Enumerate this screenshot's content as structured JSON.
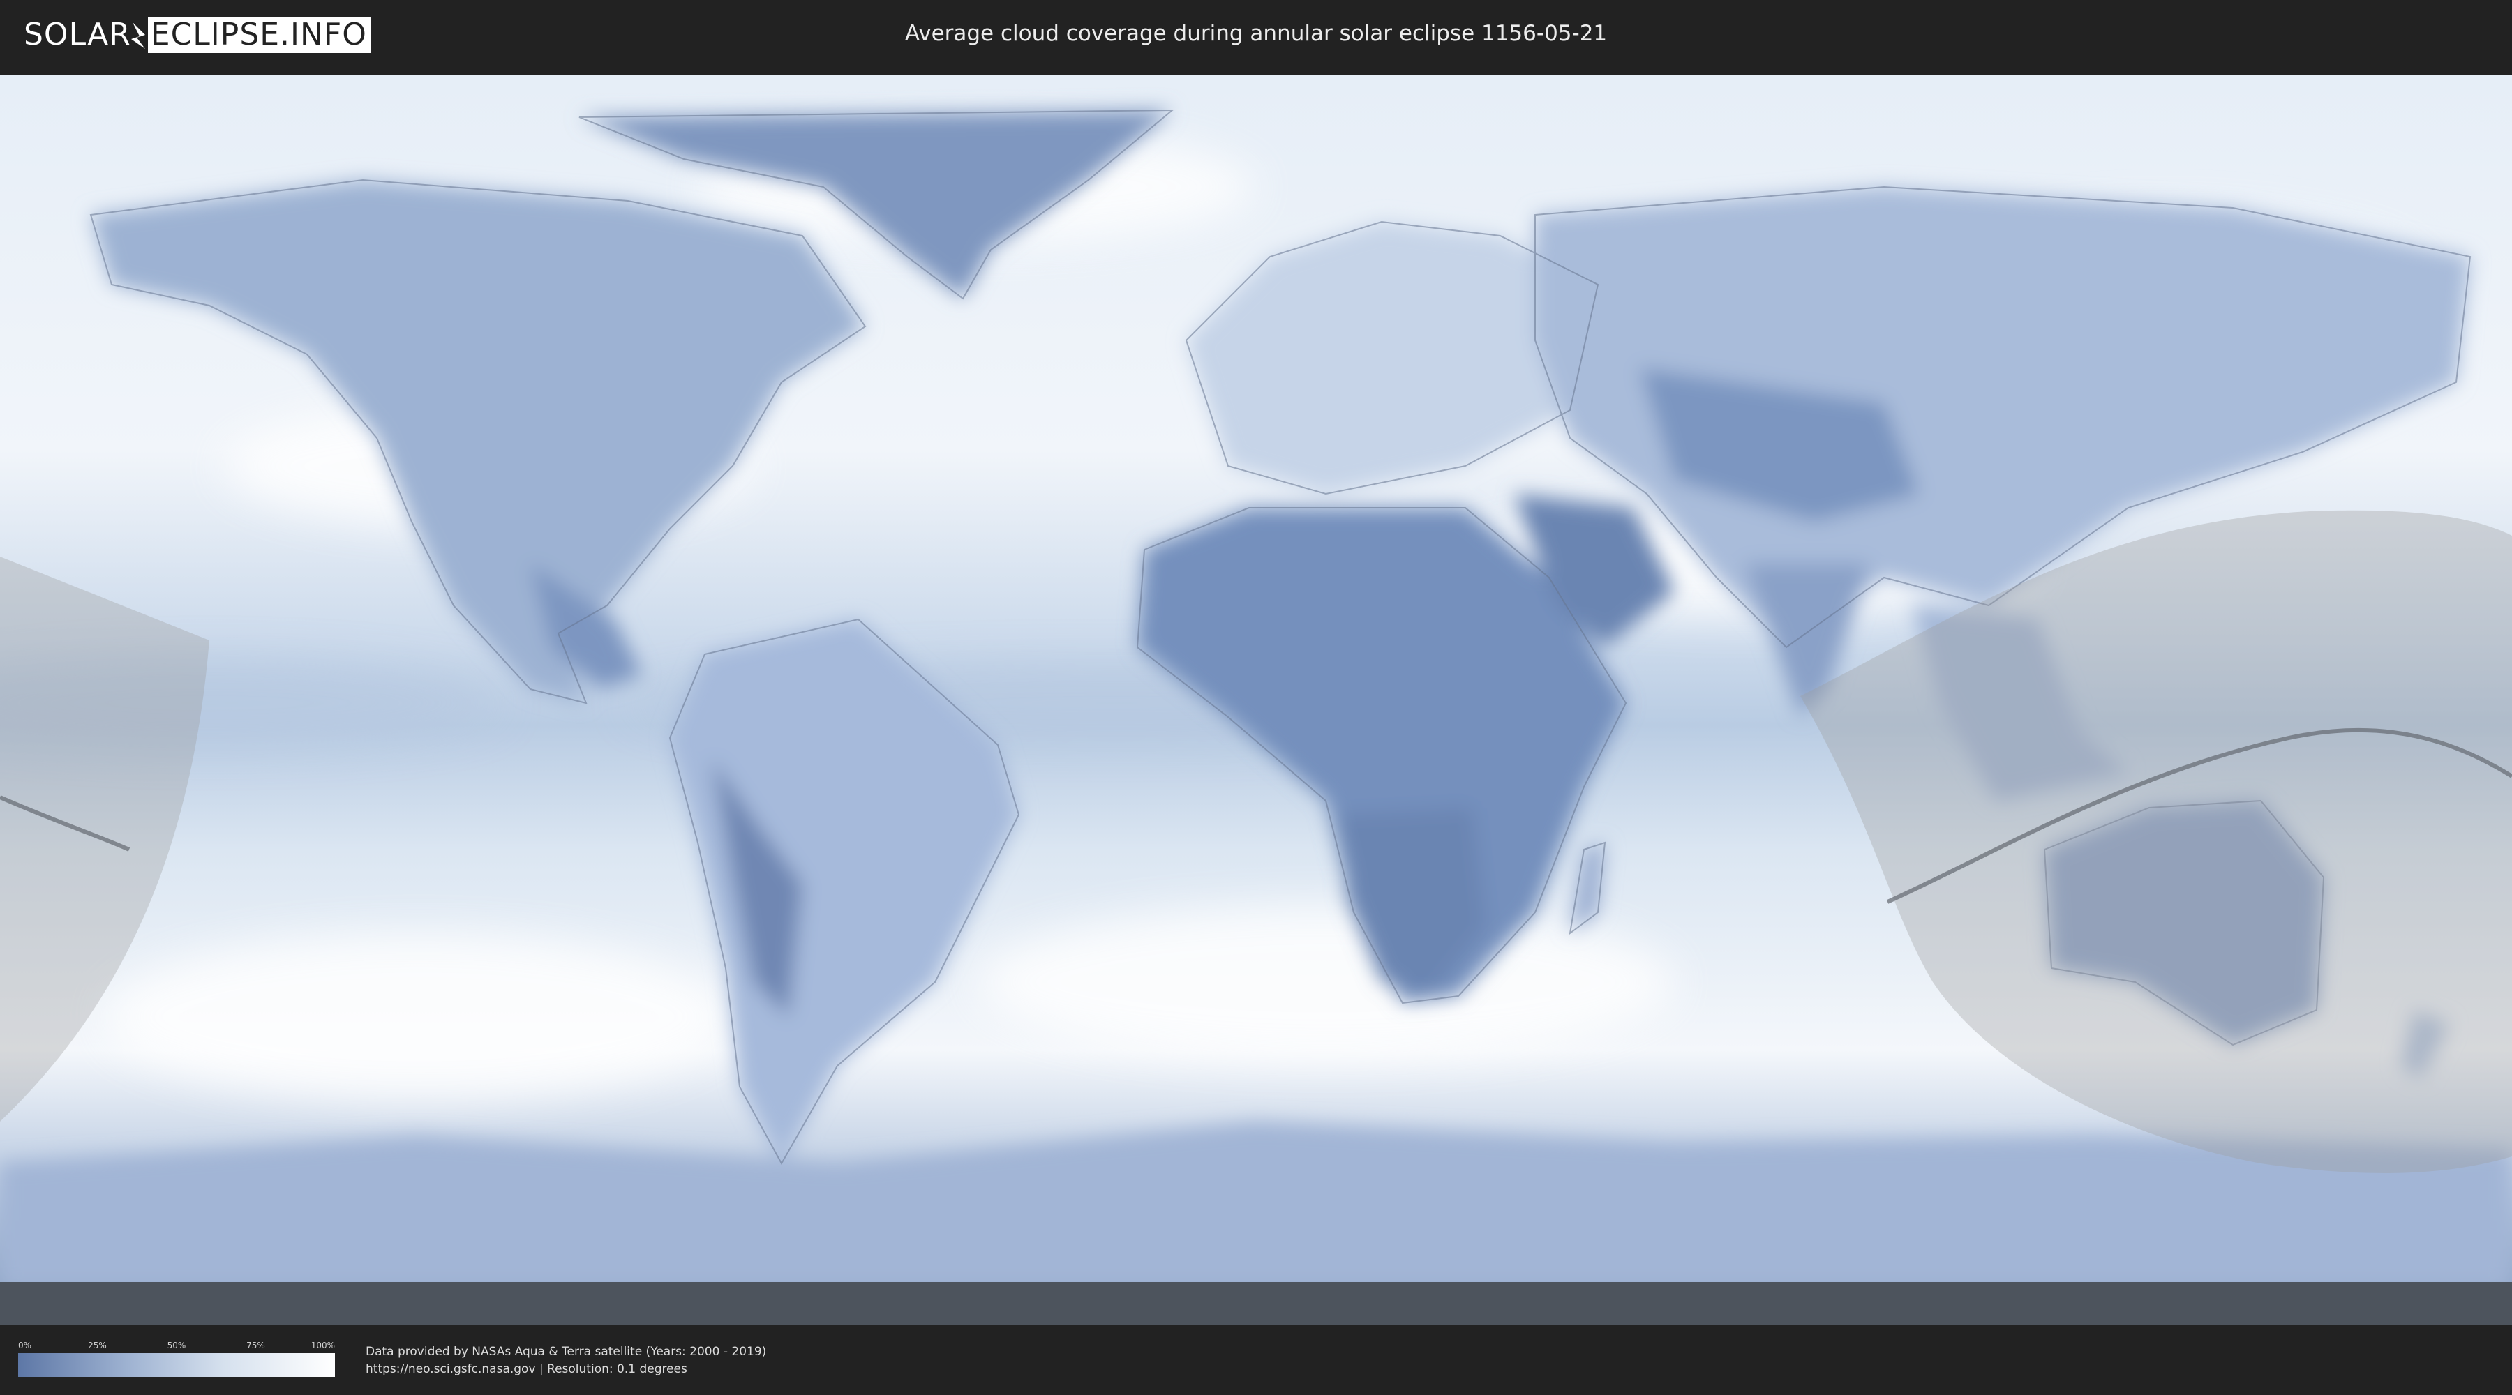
{
  "header": {
    "logo_left": "SOLAR",
    "logo_right": "ECLIPSE.INFO",
    "title": "Average cloud coverage during annular solar eclipse 1156-05-21"
  },
  "legend": {
    "ticks": [
      "0%",
      "25%",
      "50%",
      "75%",
      "100%"
    ],
    "colors": {
      "low": "#5d77a6",
      "high": "#ffffff"
    }
  },
  "credits": {
    "line1": "Data provided by NASAs Aqua & Terra satellite (Years: 2000 - 2019)",
    "line2": "https://neo.sci.gsfc.nasa.gov | Resolution: 0.1 degrees"
  },
  "map": {
    "icons": [
      "world-map",
      "eclipse-visibility-zone",
      "eclipse-path-line"
    ],
    "colors": {
      "land_cloudy": "#5f7aa8",
      "ocean_clear": "#eef3f9",
      "zone_overlay": "#bdbdbd"
    }
  }
}
